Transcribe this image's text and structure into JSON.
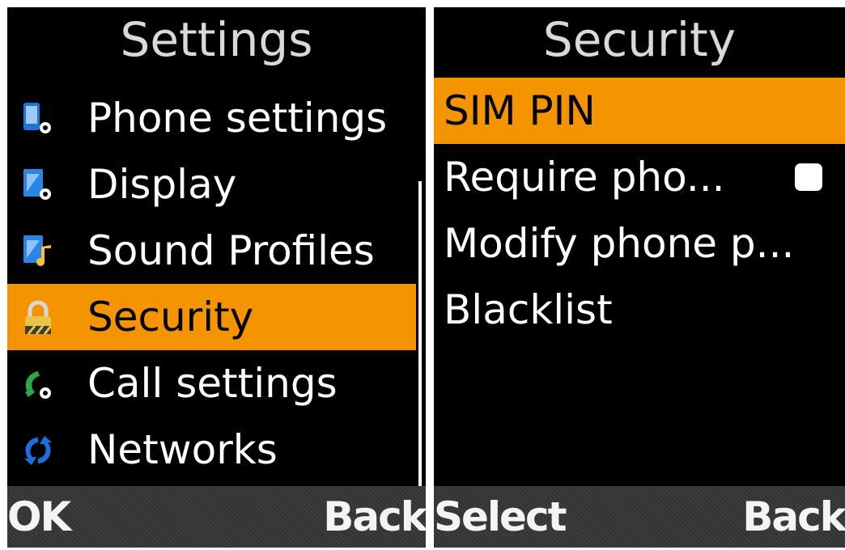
{
  "settings": {
    "title": "Settings",
    "items": [
      {
        "label": "Phone settings",
        "icon": "phone-settings-icon"
      },
      {
        "label": "Display",
        "icon": "display-settings-icon"
      },
      {
        "label": "Sound Profiles",
        "icon": "sound-profiles-icon"
      },
      {
        "label": "Security",
        "icon": "padlock-icon",
        "selected": true
      },
      {
        "label": "Call settings",
        "icon": "call-settings-icon"
      },
      {
        "label": "Networks",
        "icon": "networks-icon"
      }
    ],
    "softkeys": {
      "left": "OK",
      "right": "Back"
    }
  },
  "security": {
    "title": "Security",
    "items": [
      {
        "label": "SIM PIN",
        "selected": true
      },
      {
        "label": "Require pho...",
        "checkbox": false
      },
      {
        "label": "Modify phone p..."
      },
      {
        "label": "Blacklist"
      }
    ],
    "softkeys": {
      "left": "Select",
      "right": "Back"
    }
  },
  "colors": {
    "highlight": "#f39400",
    "background": "#000000",
    "text": "#ffffff",
    "title_text": "#d9d9d9"
  }
}
